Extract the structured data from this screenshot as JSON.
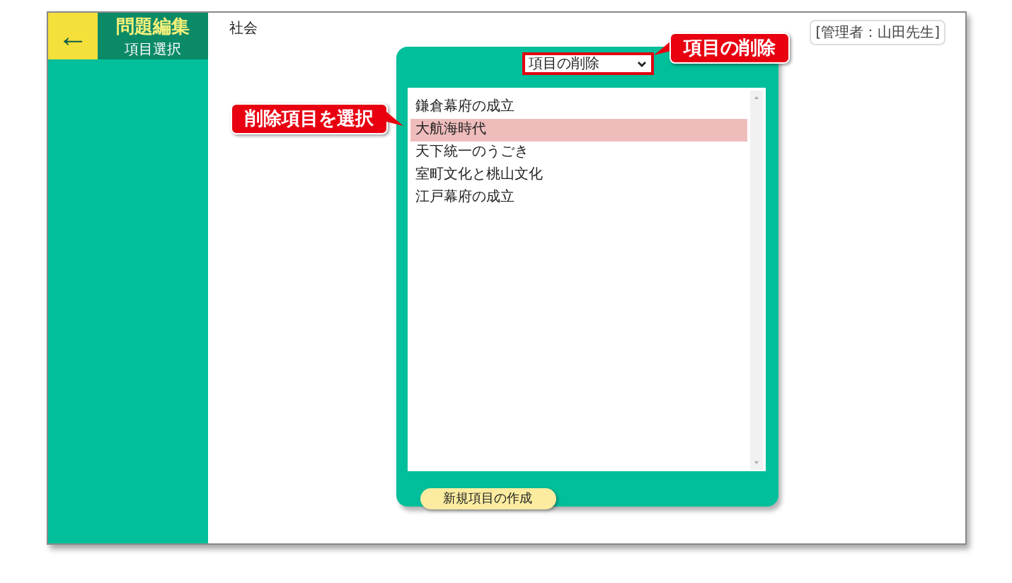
{
  "header": {
    "back_icon": "←",
    "title": "問題編集",
    "subtitle": "項目選択"
  },
  "subject": "社会",
  "admin": "[管理者：山田先生]",
  "mode_select": {
    "value": "項目の削除"
  },
  "items": [
    {
      "label": "鎌倉幕府の成立",
      "selected": false
    },
    {
      "label": "大航海時代",
      "selected": true
    },
    {
      "label": "天下統一のうごき",
      "selected": false
    },
    {
      "label": "室町文化と桃山文化",
      "selected": false
    },
    {
      "label": "江戸幕府の成立",
      "selected": false
    }
  ],
  "create_button": "新規項目の作成",
  "callouts": [
    {
      "text": "項目の削除",
      "kind": "pointleft"
    },
    {
      "text": "削除項目を選択",
      "kind": "pointright"
    }
  ]
}
